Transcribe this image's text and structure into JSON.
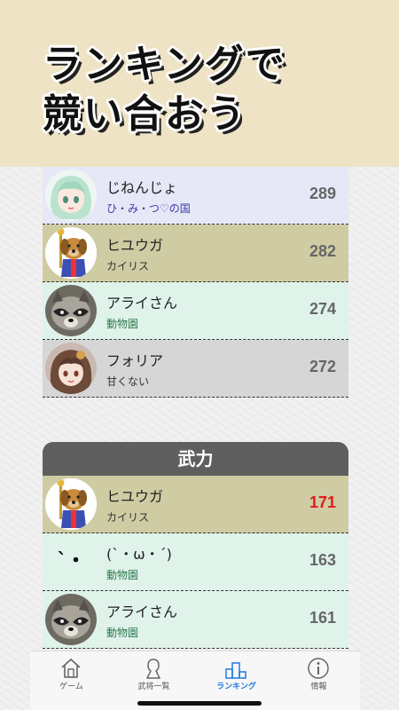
{
  "banner": {
    "line1": "ランキングで",
    "line2": "競い合おう"
  },
  "top_ranking": [
    {
      "name": "じねんじょ",
      "sub": "ひ・み・つ♡の国",
      "score": "289",
      "row_color": "#e6e8f7",
      "sub_color": "#3a3aa8",
      "avatar": "anime-girl-green-hair"
    },
    {
      "name": "ヒユウガ",
      "sub": "カイリス",
      "score": "282",
      "row_color": "#cfcba3",
      "sub_color": "#333333",
      "avatar": "dog-mascot"
    },
    {
      "name": "アライさん",
      "sub": "動物園",
      "score": "274",
      "row_color": "#dff3ea",
      "sub_color": "#2f7a4f",
      "avatar": "raccoon"
    },
    {
      "name": "フォリア",
      "sub": "甘くない",
      "score": "272",
      "row_color": "#d6d6d6",
      "sub_color": "#333333",
      "avatar": "anime-girl-brown-hair"
    }
  ],
  "section": {
    "title": "武力"
  },
  "power_ranking": [
    {
      "name": "ヒユウガ",
      "sub": "カイリス",
      "score": "171",
      "row_color": "#cfcba3",
      "sub_color": "#333333",
      "avatar": "dog-mascot",
      "highlight": true
    },
    {
      "name": "(`・ω・´)",
      "sub": "動物園",
      "score": "163",
      "row_color": "#dff3ea",
      "sub_color": "#2f7a4f",
      "avatar": "emoticon-face",
      "avatar_text": "`・ω・´"
    },
    {
      "name": "アライさん",
      "sub": "動物園",
      "score": "161",
      "row_color": "#dff3ea",
      "sub_color": "#2f7a4f",
      "avatar": "raccoon"
    }
  ],
  "tabs": [
    {
      "label": "ゲーム",
      "icon": "home-icon",
      "active": false
    },
    {
      "label": "武将一覧",
      "icon": "person-silhouette-icon",
      "active": false
    },
    {
      "label": "ランキング",
      "icon": "podium-icon",
      "active": true
    },
    {
      "label": "情報",
      "icon": "info-icon",
      "active": false
    }
  ],
  "colors": {
    "banner_bg": "#efe3c6",
    "section_header_bg": "#5f5f5f",
    "active_tab": "#1e7be0",
    "highlight_score": "#e21b1b"
  }
}
